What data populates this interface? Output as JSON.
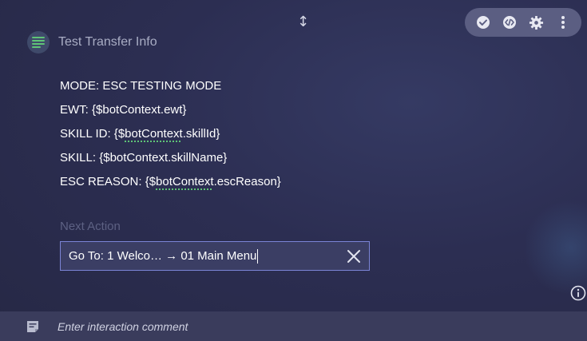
{
  "header": {
    "title": "Test Transfer Info",
    "icon": "list-lines-icon"
  },
  "toolbar": {
    "buttons": [
      "check-circle-icon",
      "code-icon",
      "gear-icon",
      "more-vertical-icon"
    ]
  },
  "message": {
    "lines": [
      {
        "prefix": "MODE: ESC TESTING MODE",
        "var": "",
        "suffix": ""
      },
      {
        "prefix": "EWT: {$",
        "var": "",
        "suffix": "botContext.ewt}"
      },
      {
        "prefix": "SKILL ID: {$",
        "var": "botContext",
        "suffix": ".skillId}"
      },
      {
        "prefix": "SKILL: {$",
        "var": "",
        "suffix": "botContext.skillName}"
      },
      {
        "prefix": "ESC REASON: {$",
        "var": "botContext",
        "suffix": ".escReason}"
      }
    ]
  },
  "next_action": {
    "label": "Next Action",
    "value": "Go To: 1 Welco…  →  01 Main Menu"
  },
  "footer": {
    "comment_placeholder": "Enter interaction comment"
  },
  "colors": {
    "toolbar_bg": "#5b5e82",
    "field_border": "#7b84d6",
    "var_underline": "#5fc477",
    "header_icon": "#5fc477"
  }
}
